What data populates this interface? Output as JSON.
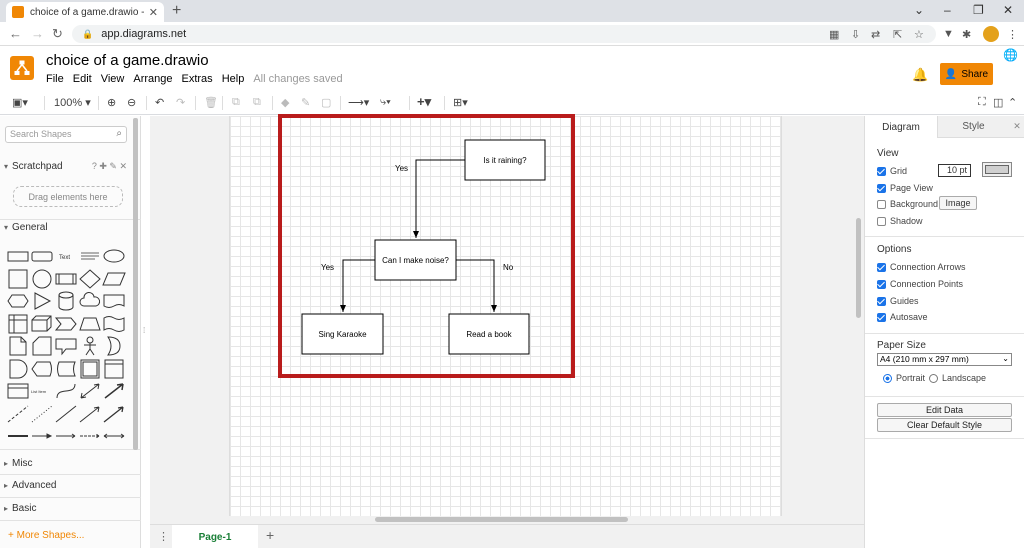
{
  "browser": {
    "tab_title": "choice of a game.drawio - diagrams.net",
    "tab_close": "✕",
    "new_tab": "+",
    "url": "app.diagrams.net",
    "window_controls": [
      "⌄",
      "–",
      "❐",
      "✕"
    ]
  },
  "app": {
    "file_title": "choice of a game.drawio",
    "menus": [
      "File",
      "Edit",
      "View",
      "Arrange",
      "Extras",
      "Help"
    ],
    "save_status": "All changes saved",
    "share_label": "Share",
    "accent_color": "#f08705"
  },
  "toolbar": {
    "zoom": "100%"
  },
  "left_panel": {
    "search_placeholder": "Search Shapes",
    "scratchpad_label": "Scratchpad",
    "scratchpad_tools": "? ✚ ✎ ✕",
    "drag_here": "Drag elements here",
    "general_label": "General",
    "misc_label": "Misc",
    "advanced_label": "Advanced",
    "basic_label": "Basic",
    "more_shapes": "+ More Shapes...",
    "shape_text_label": "Text",
    "shape_list_label": "List Item"
  },
  "diagram": {
    "nodes": {
      "q1": "Is it raining?",
      "q2": "Can I make noise?",
      "a1": "Sing Karaoke",
      "a2": "Read a book"
    },
    "edges": {
      "q1_q2": "Yes",
      "q2_a1": "Yes",
      "q2_a2": "No"
    },
    "highlight_color": "#b91c1c"
  },
  "pages": {
    "active": "Page-1",
    "add": "+"
  },
  "right_panel": {
    "tabs": [
      "Diagram",
      "Style"
    ],
    "close": "✕",
    "view_heading": "View",
    "grid_label": "Grid",
    "grid_size": "10 pt",
    "page_view_label": "Page View",
    "background_label": "Background",
    "image_button": "Image",
    "shadow_label": "Shadow",
    "options_heading": "Options",
    "connection_arrows": "Connection Arrows",
    "connection_points": "Connection Points",
    "guides": "Guides",
    "autosave": "Autosave",
    "paper_size_heading": "Paper Size",
    "paper_size_value": "A4 (210 mm x 297 mm)",
    "portrait": "Portrait",
    "landscape": "Landscape",
    "edit_data": "Edit Data",
    "clear_default_style": "Clear Default Style"
  }
}
